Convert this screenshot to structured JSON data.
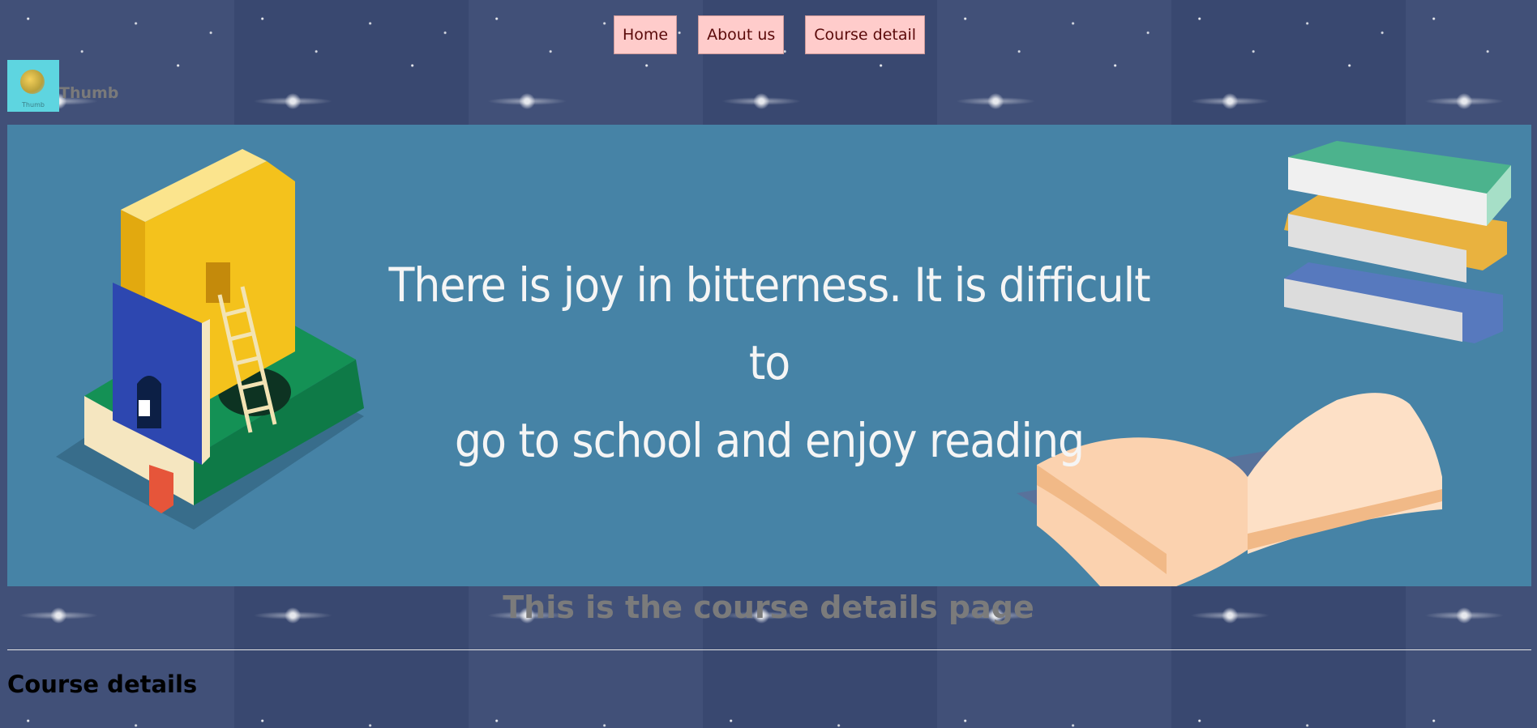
{
  "nav": {
    "items": [
      {
        "label": "Home"
      },
      {
        "label": "About us"
      },
      {
        "label": "Course detail"
      }
    ]
  },
  "logo": {
    "image_caption": "Thumb",
    "text": "Thumb"
  },
  "banner": {
    "quote_line1": "There is joy in bitterness. It is difficult to",
    "quote_line2": "go to school and enjoy reading"
  },
  "main": {
    "page_heading": "This is the course details page",
    "section_title": "Course details"
  },
  "colors": {
    "nav_button_bg": "#ffcccb",
    "banner_bg": "#4683a6",
    "page_bg": "#3b4a74"
  }
}
